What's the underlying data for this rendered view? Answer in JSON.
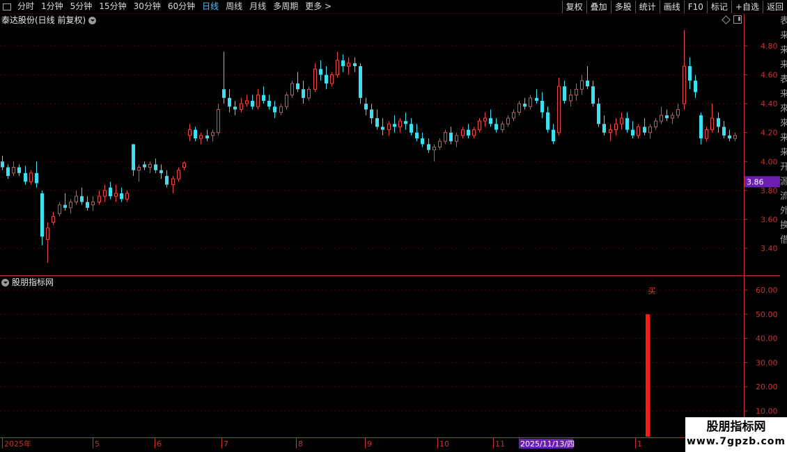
{
  "toolbar": {
    "left_items": [
      "分时",
      "1分钟",
      "5分钟",
      "15分钟",
      "30分钟",
      "60分钟",
      "日线",
      "周线",
      "月线",
      "多周期",
      "更多 >"
    ],
    "active_item": "日线",
    "right_items": [
      "复权",
      "叠加",
      "多股",
      "统计",
      "画线",
      "F10",
      "标记",
      "+自选",
      "返回"
    ]
  },
  "chart": {
    "title": "泰达股份(日线 前复权)",
    "price_ticks": [
      "4.80",
      "4.60",
      "4.40",
      "4.20",
      "4.00",
      "3.80",
      "3.60",
      "3.40"
    ],
    "current_price": "3.86",
    "colors": {
      "up": "#e84a4a",
      "down": "#3de0f0",
      "grid": "#5a0000",
      "axis": "#c83232",
      "price_bg": "#6a1fb0"
    }
  },
  "indicator": {
    "title": "股朋指标网",
    "ticks": [
      "60.00",
      "50.00",
      "40.00",
      "30.00",
      "20.00",
      "10.00"
    ],
    "signal_label": "买",
    "signal_value": 50
  },
  "date_axis": {
    "labels": [
      "2025年",
      "5",
      "6",
      "7",
      "8",
      "9",
      "10",
      "11",
      "2025/11/13/四",
      "1"
    ]
  },
  "side_strip": [
    "表",
    "来",
    "来",
    "来",
    "表",
    "来",
    "來",
    "來",
    "来",
    "来",
    "开",
    "源",
    "流",
    "外",
    "换",
    "借"
  ],
  "watermark": {
    "line1": "股朋指标网",
    "line2": "www.7gpzb.com"
  },
  "chart_data": {
    "type": "candlestick",
    "ylim": [
      3.3,
      4.9
    ],
    "indicator_ylim": [
      0,
      65
    ],
    "ohlc": [
      [
        4.0,
        4.04,
        3.94,
        3.96
      ],
      [
        3.96,
        3.98,
        3.88,
        3.9
      ],
      [
        3.92,
        4.0,
        3.9,
        3.96
      ],
      [
        3.96,
        3.98,
        3.9,
        3.92
      ],
      [
        3.92,
        3.97,
        3.84,
        3.86
      ],
      [
        3.86,
        3.94,
        3.84,
        3.92
      ],
      [
        3.92,
        4.0,
        3.82,
        3.85
      ],
      [
        3.78,
        3.8,
        3.42,
        3.48
      ],
      [
        3.46,
        3.58,
        3.3,
        3.54
      ],
      [
        3.58,
        3.65,
        3.56,
        3.62
      ],
      [
        3.64,
        3.72,
        3.62,
        3.7
      ],
      [
        3.7,
        3.78,
        3.66,
        3.68
      ],
      [
        3.68,
        3.74,
        3.64,
        3.72
      ],
      [
        3.72,
        3.8,
        3.7,
        3.76
      ],
      [
        3.76,
        3.82,
        3.7,
        3.72
      ],
      [
        3.72,
        3.76,
        3.66,
        3.68
      ],
      [
        3.7,
        3.76,
        3.66,
        3.72
      ],
      [
        3.72,
        3.8,
        3.7,
        3.76
      ],
      [
        3.76,
        3.84,
        3.72,
        3.8
      ],
      [
        3.82,
        3.86,
        3.74,
        3.76
      ],
      [
        3.76,
        3.84,
        3.72,
        3.78
      ],
      [
        3.78,
        3.82,
        3.72,
        3.74
      ],
      [
        3.74,
        3.8,
        3.72,
        3.78
      ],
      [
        4.12,
        4.12,
        3.9,
        3.94
      ],
      [
        3.94,
        3.98,
        3.86,
        3.96
      ],
      [
        3.98,
        4.0,
        3.94,
        3.96
      ],
      [
        3.96,
        4.0,
        3.92,
        3.98
      ],
      [
        3.98,
        4.02,
        3.92,
        3.94
      ],
      [
        3.94,
        3.98,
        3.88,
        3.92
      ],
      [
        3.9,
        3.94,
        3.82,
        3.84
      ],
      [
        3.84,
        3.9,
        3.78,
        3.88
      ],
      [
        3.88,
        3.96,
        3.86,
        3.94
      ],
      [
        3.96,
        4.0,
        3.94,
        3.99
      ],
      [
        4.18,
        4.26,
        4.14,
        4.22
      ],
      [
        4.22,
        4.24,
        4.14,
        4.16
      ],
      [
        4.16,
        4.2,
        4.12,
        4.18
      ],
      [
        4.18,
        4.22,
        4.14,
        4.16
      ],
      [
        4.18,
        4.22,
        4.14,
        4.2
      ],
      [
        4.2,
        4.4,
        4.18,
        4.36
      ],
      [
        4.5,
        4.76,
        4.4,
        4.44
      ],
      [
        4.44,
        4.5,
        4.34,
        4.38
      ],
      [
        4.38,
        4.42,
        4.32,
        4.36
      ],
      [
        4.36,
        4.44,
        4.34,
        4.4
      ],
      [
        4.4,
        4.46,
        4.38,
        4.42
      ],
      [
        4.42,
        4.46,
        4.36,
        4.38
      ],
      [
        4.38,
        4.5,
        4.36,
        4.46
      ],
      [
        4.46,
        4.52,
        4.4,
        4.42
      ],
      [
        4.42,
        4.46,
        4.36,
        4.38
      ],
      [
        4.38,
        4.42,
        4.3,
        4.34
      ],
      [
        4.34,
        4.4,
        4.32,
        4.38
      ],
      [
        4.38,
        4.48,
        4.36,
        4.46
      ],
      [
        4.46,
        4.56,
        4.44,
        4.54
      ],
      [
        4.54,
        4.62,
        4.48,
        4.5
      ],
      [
        4.5,
        4.56,
        4.4,
        4.44
      ],
      [
        4.44,
        4.52,
        4.42,
        4.5
      ],
      [
        4.5,
        4.68,
        4.48,
        4.64
      ],
      [
        4.64,
        4.7,
        4.56,
        4.6
      ],
      [
        4.6,
        4.66,
        4.5,
        4.54
      ],
      [
        4.54,
        4.62,
        4.52,
        4.6
      ],
      [
        4.6,
        4.76,
        4.58,
        4.7
      ],
      [
        4.7,
        4.74,
        4.62,
        4.66
      ],
      [
        4.66,
        4.72,
        4.6,
        4.68
      ],
      [
        4.68,
        4.72,
        4.62,
        4.66
      ],
      [
        4.66,
        4.68,
        4.4,
        4.44
      ],
      [
        4.4,
        4.44,
        4.32,
        4.36
      ],
      [
        4.36,
        4.4,
        4.26,
        4.3
      ],
      [
        4.3,
        4.36,
        4.22,
        4.24
      ],
      [
        4.24,
        4.3,
        4.18,
        4.22
      ],
      [
        4.22,
        4.28,
        4.18,
        4.26
      ],
      [
        4.26,
        4.32,
        4.2,
        4.24
      ],
      [
        4.24,
        4.3,
        4.2,
        4.28
      ],
      [
        4.28,
        4.34,
        4.22,
        4.26
      ],
      [
        4.26,
        4.3,
        4.18,
        4.2
      ],
      [
        4.2,
        4.26,
        4.14,
        4.16
      ],
      [
        4.16,
        4.2,
        4.1,
        4.12
      ],
      [
        4.12,
        4.16,
        4.06,
        4.08
      ],
      [
        4.08,
        4.12,
        4.0,
        4.1
      ],
      [
        4.1,
        4.16,
        4.08,
        4.14
      ],
      [
        4.14,
        4.22,
        4.12,
        4.2
      ],
      [
        4.2,
        4.24,
        4.12,
        4.14
      ],
      [
        4.14,
        4.2,
        4.1,
        4.18
      ],
      [
        4.18,
        4.24,
        4.16,
        4.22
      ],
      [
        4.22,
        4.26,
        4.16,
        4.18
      ],
      [
        4.18,
        4.24,
        4.16,
        4.22
      ],
      [
        4.22,
        4.3,
        4.2,
        4.28
      ],
      [
        4.28,
        4.34,
        4.24,
        4.3
      ],
      [
        4.3,
        4.36,
        4.24,
        4.26
      ],
      [
        4.26,
        4.3,
        4.2,
        4.22
      ],
      [
        4.22,
        4.28,
        4.2,
        4.26
      ],
      [
        4.26,
        4.32,
        4.24,
        4.3
      ],
      [
        4.3,
        4.36,
        4.28,
        4.34
      ],
      [
        4.34,
        4.42,
        4.32,
        4.4
      ],
      [
        4.4,
        4.44,
        4.36,
        4.38
      ],
      [
        4.38,
        4.46,
        4.36,
        4.44
      ],
      [
        4.44,
        4.5,
        4.4,
        4.42
      ],
      [
        4.42,
        4.48,
        4.3,
        4.34
      ],
      [
        4.34,
        4.38,
        4.2,
        4.22
      ],
      [
        4.22,
        4.26,
        4.12,
        4.14
      ],
      [
        4.2,
        4.58,
        4.18,
        4.52
      ],
      [
        4.52,
        4.56,
        4.4,
        4.42
      ],
      [
        4.42,
        4.5,
        4.38,
        4.46
      ],
      [
        4.46,
        4.54,
        4.42,
        4.5
      ],
      [
        4.5,
        4.6,
        4.46,
        4.56
      ],
      [
        4.56,
        4.66,
        4.5,
        4.52
      ],
      [
        4.52,
        4.56,
        4.38,
        4.4
      ],
      [
        4.4,
        4.44,
        4.24,
        4.26
      ],
      [
        4.26,
        4.32,
        4.18,
        4.2
      ],
      [
        4.2,
        4.26,
        4.14,
        4.22
      ],
      [
        4.22,
        4.3,
        4.18,
        4.26
      ],
      [
        4.26,
        4.34,
        4.22,
        4.3
      ],
      [
        4.3,
        4.34,
        4.2,
        4.22
      ],
      [
        4.22,
        4.28,
        4.16,
        4.18
      ],
      [
        4.18,
        4.26,
        4.16,
        4.24
      ],
      [
        4.24,
        4.3,
        4.18,
        4.2
      ],
      [
        4.2,
        4.26,
        4.16,
        4.24
      ],
      [
        4.24,
        4.3,
        4.22,
        4.28
      ],
      [
        4.28,
        4.38,
        4.26,
        4.32
      ],
      [
        4.32,
        4.36,
        4.28,
        4.3
      ],
      [
        4.3,
        4.34,
        4.26,
        4.32
      ],
      [
        4.32,
        4.4,
        4.3,
        4.36
      ],
      [
        4.4,
        4.91,
        4.36,
        4.66
      ],
      [
        4.66,
        4.72,
        4.5,
        4.56
      ],
      [
        4.56,
        4.6,
        4.44,
        4.48
      ],
      [
        4.32,
        4.34,
        4.12,
        4.16
      ],
      [
        4.16,
        4.24,
        4.14,
        4.22
      ],
      [
        4.22,
        4.4,
        4.2,
        4.3
      ],
      [
        4.3,
        4.34,
        4.2,
        4.24
      ],
      [
        4.24,
        4.28,
        4.16,
        4.18
      ],
      [
        4.18,
        4.22,
        4.14,
        4.16
      ],
      [
        4.16,
        4.2,
        4.14,
        4.18
      ]
    ],
    "signal_index": 119
  }
}
